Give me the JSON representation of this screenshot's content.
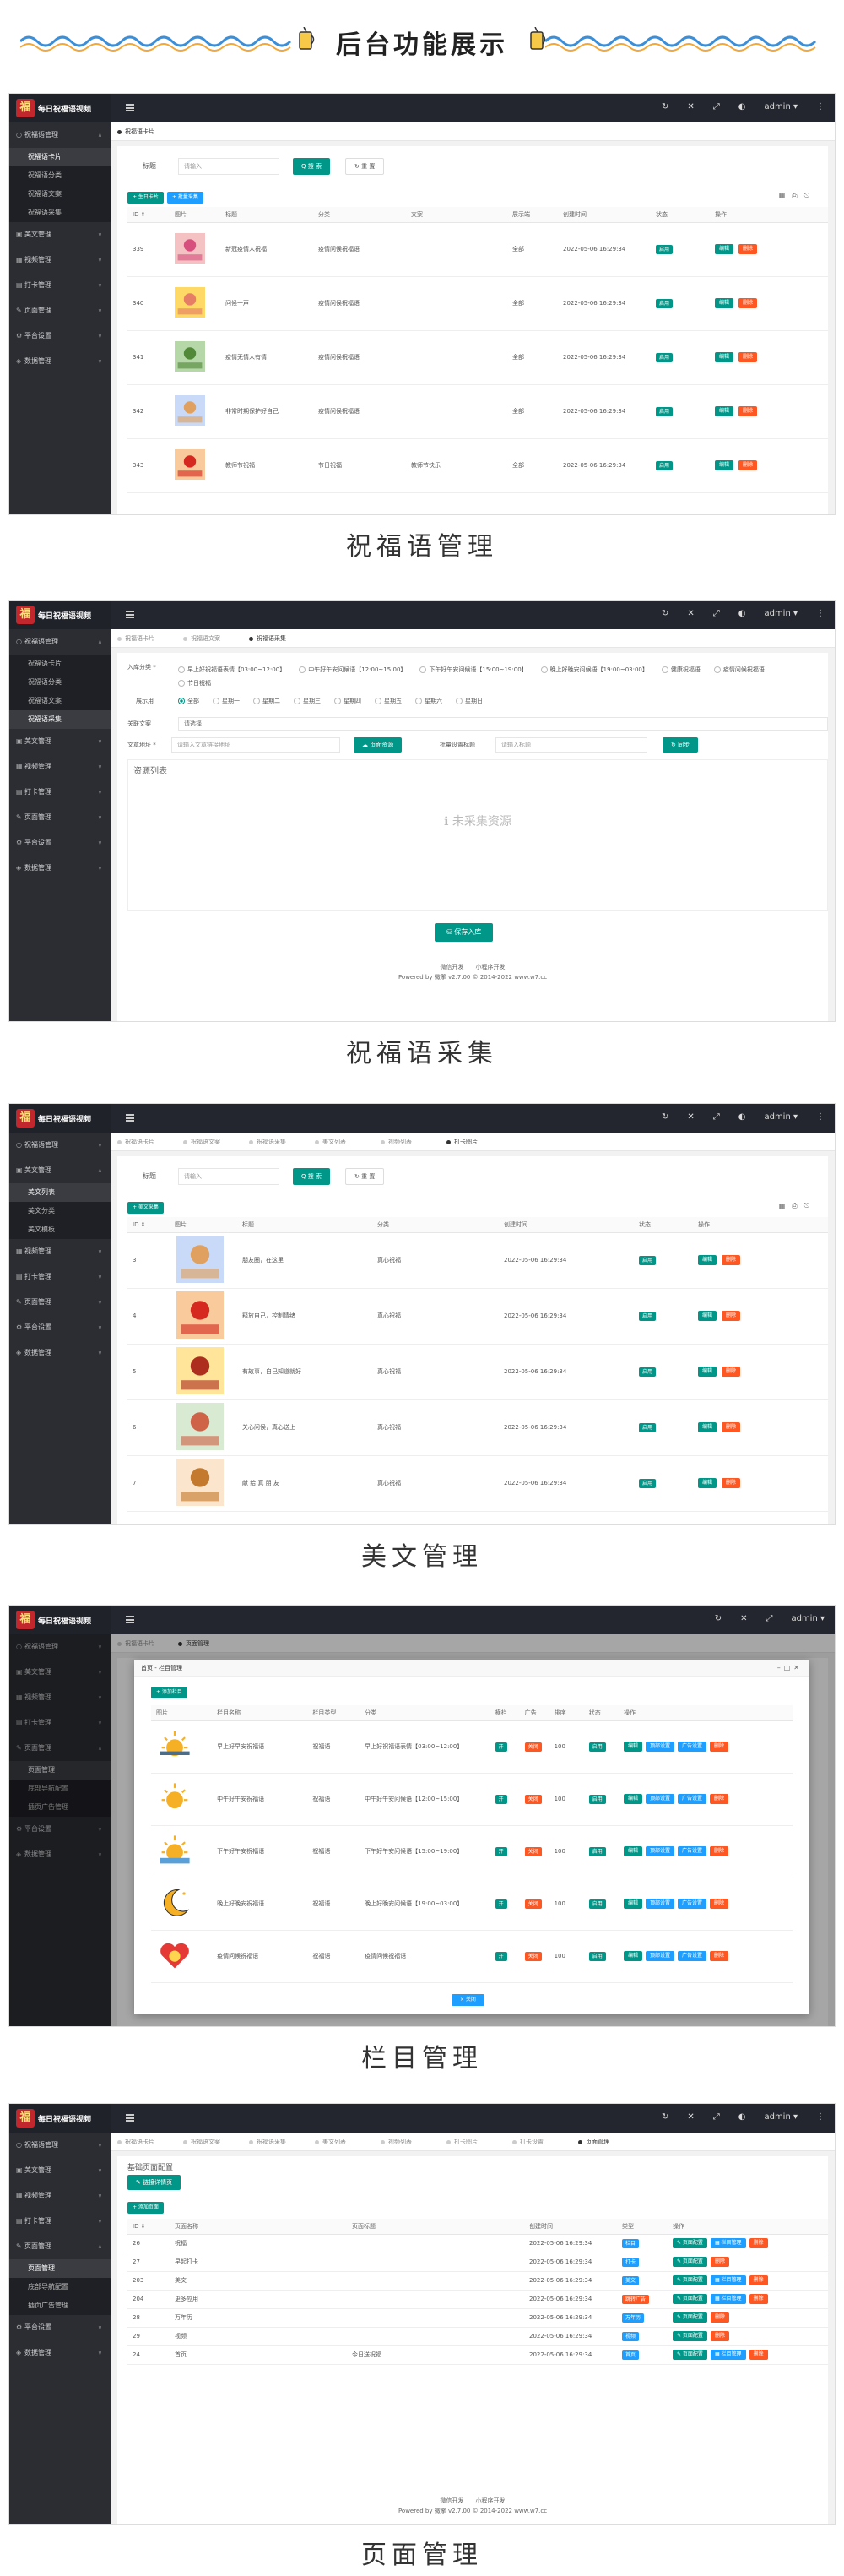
{
  "banner": {
    "title": "后台功能展示"
  },
  "common": {
    "logo_text": "每日祝福语视频",
    "admin": "admin ▾",
    "footer_links": "微信开发　　小程序开发",
    "footer_powered": "Powered by 微擎 v2.7.00 © 2014-2022 www.w7.cc",
    "search_label": "标题",
    "search_placeholder": "请输入",
    "search_btn": "Q 搜 索",
    "reset_btn": "↻ 重 置",
    "edit": "编辑",
    "del": "删除",
    "status_ok": "启用"
  },
  "section1": {
    "caption": "祝福语管理",
    "sidebar": [
      {
        "icon": "○",
        "label": "祝福语管理",
        "arrow": "∧"
      },
      {
        "icon": "",
        "label": "祝福语卡片",
        "sub": true,
        "active": true
      },
      {
        "icon": "",
        "label": "祝福语分类",
        "sub": true
      },
      {
        "icon": "",
        "label": "祝福语文案",
        "sub": true
      },
      {
        "icon": "",
        "label": "祝福语采集",
        "sub": true
      },
      {
        "icon": "▣",
        "label": "美文管理",
        "arrow": "∨"
      },
      {
        "icon": "▦",
        "label": "视频管理",
        "arrow": "∨"
      },
      {
        "icon": "▤",
        "label": "打卡管理",
        "arrow": "∨"
      },
      {
        "icon": "✎",
        "label": "页面管理",
        "arrow": "∨"
      },
      {
        "icon": "⚙",
        "label": "平台设置",
        "arrow": "∨"
      },
      {
        "icon": "◈",
        "label": "数据管理",
        "arrow": "∨"
      }
    ],
    "tabs": [
      "祝福语卡片"
    ],
    "toolbar": [
      "+ 生日卡片",
      "+ 批量采集"
    ],
    "columns": [
      "ID ⇕",
      "图片",
      "标题",
      "分类",
      "文案",
      "展示端",
      "创建时间",
      "状态",
      "操作"
    ],
    "rows": [
      {
        "id": "339",
        "title": "新冠疫情人祝福",
        "cat": "疫情问候祝福语",
        "text": "",
        "side": "全部",
        "time": "2022-05-06 16:29:34"
      },
      {
        "id": "340",
        "title": "问候一声",
        "cat": "疫情问候祝福语",
        "text": "",
        "side": "全部",
        "time": "2022-05-06 16:29:34"
      },
      {
        "id": "341",
        "title": "疫情无情人有情",
        "cat": "疫情问候祝福语",
        "text": "",
        "side": "全部",
        "time": "2022-05-06 16:29:34"
      },
      {
        "id": "342",
        "title": "非常时期保护好自己",
        "cat": "疫情问候祝福语",
        "text": "",
        "side": "全部",
        "time": "2022-05-06 16:29:34"
      },
      {
        "id": "343",
        "title": "教师节祝福",
        "cat": "节日祝福",
        "text": "教师节快乐",
        "side": "全部",
        "time": "2022-05-06 16:29:34"
      }
    ]
  },
  "section2": {
    "caption": "祝福语采集",
    "sidebar": [
      {
        "icon": "○",
        "label": "祝福语管理",
        "arrow": "∧"
      },
      {
        "icon": "",
        "label": "祝福语卡片",
        "sub": true
      },
      {
        "icon": "",
        "label": "祝福语分类",
        "sub": true
      },
      {
        "icon": "",
        "label": "祝福语文案",
        "sub": true
      },
      {
        "icon": "",
        "label": "祝福语采集",
        "sub": true,
        "active": true
      },
      {
        "icon": "▣",
        "label": "美文管理",
        "arrow": "∨"
      },
      {
        "icon": "▦",
        "label": "视频管理",
        "arrow": "∨"
      },
      {
        "icon": "▤",
        "label": "打卡管理",
        "arrow": "∨"
      },
      {
        "icon": "✎",
        "label": "页面管理",
        "arrow": "∨"
      },
      {
        "icon": "⚙",
        "label": "平台设置",
        "arrow": "∨"
      },
      {
        "icon": "◈",
        "label": "数据管理",
        "arrow": "∨"
      }
    ],
    "tabs": [
      "祝福语卡片",
      "祝福语文案",
      "祝福语采集"
    ],
    "category_label": "入库分类 *",
    "categories": [
      "早上好祝福语表情【03:00~12:00】",
      "中午好午安问候语【12:00~15:00】",
      "下午好午安问候语【15:00~19:00】",
      "晚上好晚安问候语【19:00~03:00】",
      "健康祝福语",
      "疫情问候祝福语",
      "节日祝福"
    ],
    "show_label": "展示用",
    "weekdays": [
      "全部",
      "星期一",
      "星期二",
      "星期三",
      "星期四",
      "星期五",
      "星期六",
      "星期日"
    ],
    "text_label": "关联文案",
    "text_placeholder": "请选择",
    "url_label": "文章地址 *",
    "url_placeholder": "请输入文章链接地址",
    "parse_btn": "☁ 页面资源",
    "batch_label": "批量设置标题",
    "batch_placeholder": "请输入标题",
    "sync_btn": "↻ 同步",
    "list_label": "资源列表",
    "empty": "ℹ 未采集资源",
    "save_btn": "⛁ 保存入库"
  },
  "section3": {
    "caption": "美文管理",
    "sidebar": [
      {
        "icon": "○",
        "label": "祝福语管理",
        "arrow": "∨"
      },
      {
        "icon": "▣",
        "label": "美文管理",
        "arrow": "∧"
      },
      {
        "icon": "",
        "label": "美文列表",
        "sub": true,
        "active": true
      },
      {
        "icon": "",
        "label": "美文分类",
        "sub": true
      },
      {
        "icon": "",
        "label": "美文模板",
        "sub": true
      },
      {
        "icon": "▦",
        "label": "视频管理",
        "arrow": "∨"
      },
      {
        "icon": "▤",
        "label": "打卡管理",
        "arrow": "∨"
      },
      {
        "icon": "✎",
        "label": "页面管理",
        "arrow": "∨"
      },
      {
        "icon": "⚙",
        "label": "平台设置",
        "arrow": "∨"
      },
      {
        "icon": "◈",
        "label": "数据管理",
        "arrow": "∨"
      }
    ],
    "tabs": [
      "祝福语卡片",
      "祝福语文案",
      "祝福语采集",
      "美文列表",
      "视频列表",
      "打卡图片"
    ],
    "toolbar": [
      "+ 美文采集"
    ],
    "columns": [
      "ID ⇕",
      "图片",
      "标题",
      "分类",
      "创建时间",
      "状态",
      "操作"
    ],
    "rows": [
      {
        "id": "3",
        "title": "朋友圈，在这里",
        "cat": "真心祝福",
        "time": "2022-05-06 16:29:34"
      },
      {
        "id": "4",
        "title": "释放自己，控制情绪",
        "cat": "真心祝福",
        "time": "2022-05-06 16:29:34"
      },
      {
        "id": "5",
        "title": "有故事，自己知道就好",
        "cat": "真心祝福",
        "time": "2022-05-06 16:29:34"
      },
      {
        "id": "6",
        "title": "关心问候，真心送上",
        "cat": "真心祝福",
        "time": "2022-05-06 16:29:34"
      },
      {
        "id": "7",
        "title": "献 给 真 朋 友",
        "cat": "真心祝福",
        "time": "2022-05-06 16:29:34"
      }
    ]
  },
  "section4": {
    "caption": "栏目管理",
    "modal_title": "首页 - 栏目管理",
    "modal_add": "+ 添加栏目",
    "close_btn": "× 关闭",
    "columns": [
      "图片",
      "栏目名称",
      "栏目类型",
      "分类",
      "横栏",
      "广告",
      "排序",
      "状态",
      "操作"
    ],
    "rows": [
      {
        "name": "早上好早安祝福语",
        "type": "祝福语",
        "cat": "早上好祝福语表情【03:00~12:00】",
        "sort": "100"
      },
      {
        "name": "中午好午安祝福语",
        "type": "祝福语",
        "cat": "中午好午安问候语【12:00~15:00】",
        "sort": "100"
      },
      {
        "name": "下午好午安祝福语",
        "type": "祝福语",
        "cat": "下午好午安问候语【15:00~19:00】",
        "sort": "100"
      },
      {
        "name": "晚上好晚安祝福语",
        "type": "祝福语",
        "cat": "晚上好晚安问候语【19:00~03:00】",
        "sort": "100"
      },
      {
        "name": "疫情问候祝福语",
        "type": "祝福语",
        "cat": "疫情问候祝福语",
        "sort": "100"
      }
    ],
    "actions": [
      "编辑",
      "顶部设置",
      "广告设置",
      "删除"
    ]
  },
  "section5": {
    "caption": "页面管理",
    "sidebar": [
      {
        "icon": "○",
        "label": "祝福语管理",
        "arrow": "∨"
      },
      {
        "icon": "▣",
        "label": "美文管理",
        "arrow": "∨"
      },
      {
        "icon": "▦",
        "label": "视频管理",
        "arrow": "∨"
      },
      {
        "icon": "▤",
        "label": "打卡管理",
        "arrow": "∨"
      },
      {
        "icon": "✎",
        "label": "页面管理",
        "arrow": "∧"
      },
      {
        "icon": "",
        "label": "页面管理",
        "sub": true,
        "active": true
      },
      {
        "icon": "",
        "label": "底部导航配置",
        "sub": true
      },
      {
        "icon": "",
        "label": "插页广告管理",
        "sub": true
      },
      {
        "icon": "⚙",
        "label": "平台设置",
        "arrow": "∨"
      },
      {
        "icon": "◈",
        "label": "数据管理",
        "arrow": "∨"
      }
    ],
    "tabs": [
      "祝福语卡片",
      "祝福语文案",
      "祝福语采集",
      "美文列表",
      "视频列表",
      "打卡图片",
      "打卡设置",
      "页面管理"
    ],
    "base_title": "基础页面配置",
    "base_btn": "✎ 链接详情页",
    "add_btn": "+ 添加页面",
    "columns": [
      "ID ⇕",
      "页面名称",
      "页面标题",
      "创建时间",
      "类型",
      "操作"
    ],
    "rows": [
      {
        "id": "26",
        "name": "祝福",
        "title": "",
        "time": "2022-05-06 16:29:34",
        "type": "栏目"
      },
      {
        "id": "27",
        "name": "早起打卡",
        "title": "",
        "time": "2022-05-06 16:29:34",
        "type": "打卡"
      },
      {
        "id": "203",
        "name": "美文",
        "title": "",
        "time": "2022-05-06 16:29:34",
        "type": "美文"
      },
      {
        "id": "204",
        "name": "更多应用",
        "title": "",
        "time": "2022-05-06 16:29:34",
        "type": "跳转广告"
      },
      {
        "id": "28",
        "name": "万年历",
        "title": "",
        "time": "2022-05-06 16:29:34",
        "type": "万年历"
      },
      {
        "id": "29",
        "name": "视频",
        "title": "",
        "time": "2022-05-06 16:29:34",
        "type": "视频"
      },
      {
        "id": "24",
        "name": "首页",
        "title": "今日送祝福",
        "time": "2022-05-06 16:29:34",
        "type": "首页"
      }
    ],
    "row_actions": [
      "✎ 页面配置",
      "▦ 栏目管理",
      "删除"
    ]
  }
}
